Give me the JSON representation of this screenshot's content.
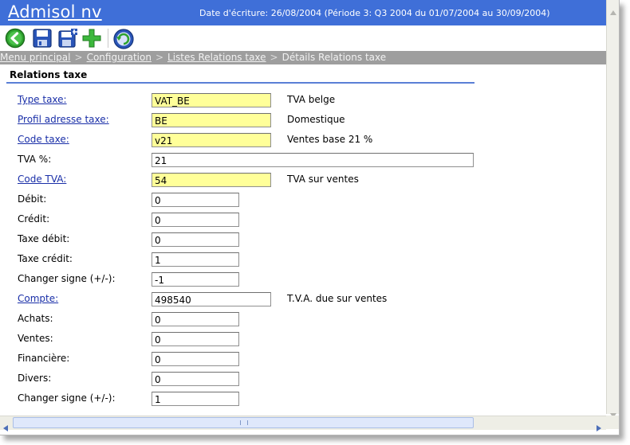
{
  "app": {
    "title": "Admisol nv",
    "date_info": "Date d'écriture: 26/08/2004 (Période 3: Q3 2004 du 01/07/2004 au 30/09/2004)"
  },
  "toolbar": {
    "buttons": [
      "back-icon",
      "save-icon",
      "save-new-icon",
      "add-icon",
      "refresh-icon"
    ],
    "colors": {
      "green": "#2fa32f",
      "blue": "#2a55b8"
    }
  },
  "breadcrumb": {
    "items": [
      "Menu principal",
      "Configuration",
      "Listes Relations taxe"
    ],
    "separator": ">",
    "current": "Détails Relations taxe"
  },
  "section": {
    "title": "Relations taxe"
  },
  "fields": {
    "type_taxe": {
      "label": "Type taxe:",
      "value": "VAT_BE",
      "desc": "TVA belge"
    },
    "profil": {
      "label": "Profil adresse taxe:",
      "value": "BE",
      "desc": "Domestique"
    },
    "code_taxe": {
      "label": "Code taxe:",
      "value": "v21",
      "desc": "Ventes base 21 %"
    },
    "tva_pct": {
      "label": "TVA %:",
      "value": "21"
    },
    "code_tva": {
      "label": "Code TVA:",
      "value": "54",
      "desc": "TVA sur ventes"
    },
    "debit": {
      "label": "Débit:",
      "value": "0"
    },
    "credit": {
      "label": "Crédit:",
      "value": "0"
    },
    "taxe_debit": {
      "label": "Taxe débit:",
      "value": "0"
    },
    "taxe_credit": {
      "label": "Taxe crédit:",
      "value": "1"
    },
    "changer_signe_1": {
      "label": "Changer signe (+/-):",
      "value": "-1"
    },
    "compte": {
      "label": "Compte:",
      "value": "498540",
      "desc": "T.V.A. due sur ventes"
    },
    "achats": {
      "label": "Achats:",
      "value": "0"
    },
    "ventes": {
      "label": "Ventes:",
      "value": "0"
    },
    "financiere": {
      "label": "Financière:",
      "value": "0"
    },
    "divers": {
      "label": "Divers:",
      "value": "0"
    },
    "changer_signe_2": {
      "label": "Changer signe (+/-):",
      "value": "1"
    }
  },
  "colors": {
    "header": "#3f6fd8",
    "breadcrumb_bg": "#9e9e9e",
    "required_field": "#ffff99",
    "link": "#1a2fa8"
  }
}
